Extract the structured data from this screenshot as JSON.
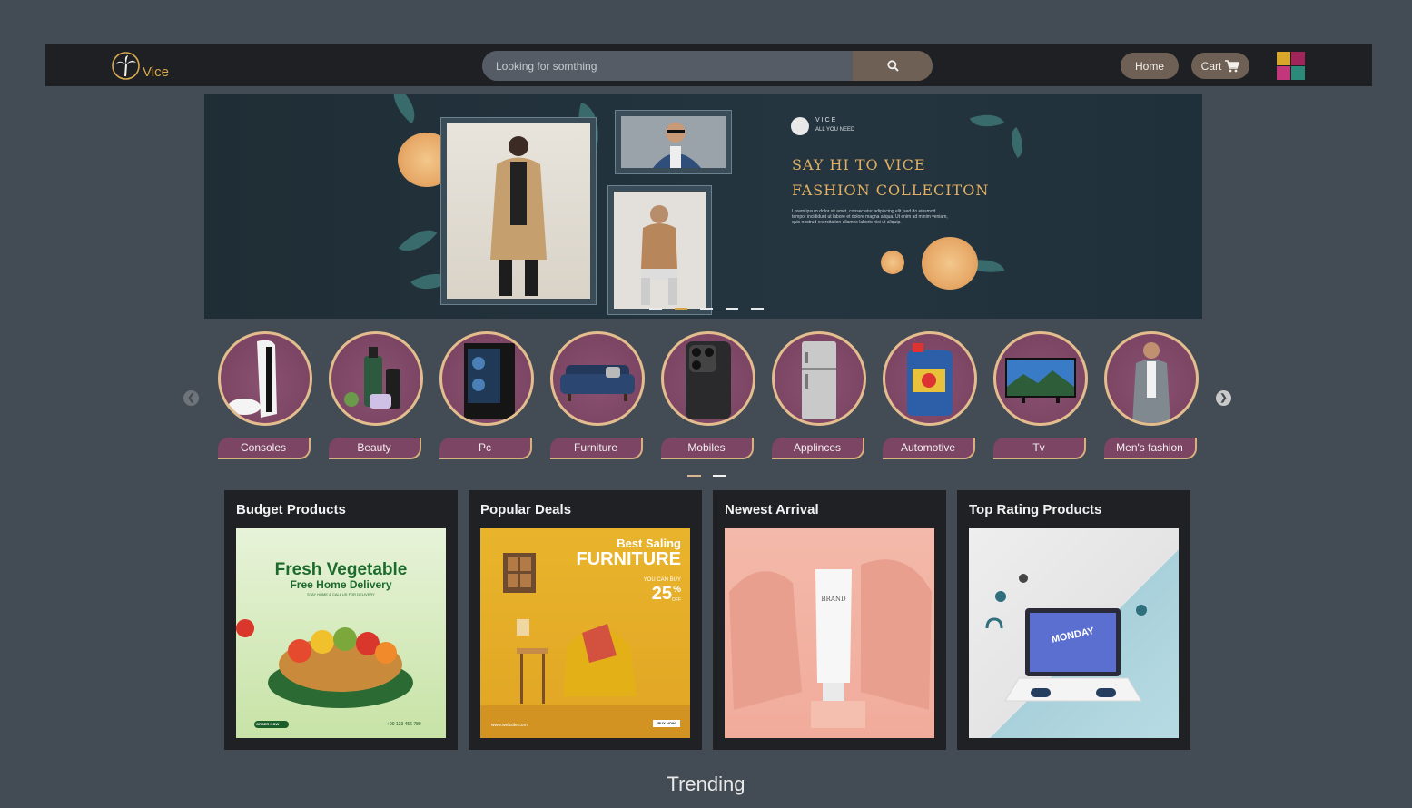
{
  "nav": {
    "logo_text": "Vice",
    "search_placeholder": "Looking for somthing",
    "home_label": "Home",
    "cart_label": "Cart",
    "colors": {
      "bar": "#1e2023",
      "accent": "#6e6055",
      "gold": "#d7a94f"
    }
  },
  "banner": {
    "brand_name": "VICE",
    "brand_tagline": "ALL YOU NEED",
    "title_line1": "SAY HI TO VICE",
    "title_line2": "FASHION COLLECITON",
    "body": "Lorem ipsum dolor sit amet, consectetur adipiscing elit, sed do eiusmod tempor incididunt ut labore et dolore magna aliqua. Ut enim ad minim veniam, quis nostrud exercitation ullamco laboris nisi ut aliquip."
  },
  "categories": [
    {
      "label": "Consoles",
      "icon": "console-icon"
    },
    {
      "label": "Beauty",
      "icon": "beauty-icon"
    },
    {
      "label": "Pc",
      "icon": "pc-icon"
    },
    {
      "label": "Furniture",
      "icon": "sofa-icon"
    },
    {
      "label": "Mobiles",
      "icon": "phone-icon"
    },
    {
      "label": "Applinces",
      "icon": "fridge-icon"
    },
    {
      "label": "Automotive",
      "icon": "oil-can-icon"
    },
    {
      "label": "Tv",
      "icon": "tv-icon"
    },
    {
      "label": "Men's fashion",
      "icon": "man-icon"
    }
  ],
  "cards": [
    {
      "title": "Budget Products",
      "promo": {
        "line1": "Fresh Vegetable",
        "line2": "Free Home Delivery",
        "small": "STAY HOME & CALL US FOR DELIVERY",
        "button": "ORDER NOW",
        "phone": "+00 123 456 789"
      }
    },
    {
      "title": "Popular Deals",
      "promo": {
        "line1": "Best Saling",
        "line2": "FURNITURE",
        "small": "YOU CAN BUY",
        "percent": "25",
        "off": "OFF",
        "site": "www.website.com",
        "button": "BUY NOW"
      }
    },
    {
      "title": "Newest Arrival",
      "promo": {
        "brand": "BRAND"
      }
    },
    {
      "title": "Top Rating Products",
      "promo": {
        "text": "MONDAY"
      }
    }
  ],
  "section_heading": "Trending"
}
